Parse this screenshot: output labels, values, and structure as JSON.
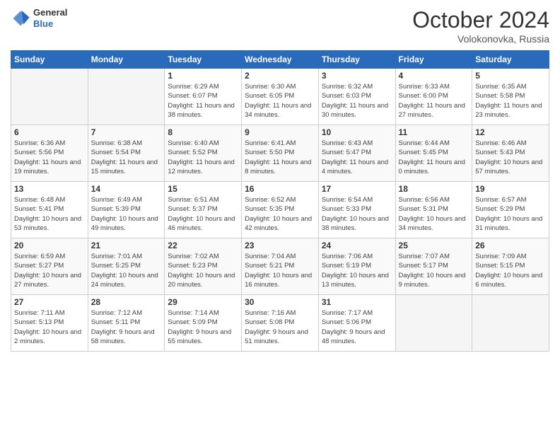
{
  "header": {
    "logo": {
      "general": "General",
      "blue": "Blue"
    },
    "title": "October 2024",
    "location": "Volokonovka, Russia"
  },
  "weekdays": [
    "Sunday",
    "Monday",
    "Tuesday",
    "Wednesday",
    "Thursday",
    "Friday",
    "Saturday"
  ],
  "weeks": [
    [
      {
        "day": "",
        "sunrise": "",
        "sunset": "",
        "daylight": "",
        "empty": true
      },
      {
        "day": "",
        "sunrise": "",
        "sunset": "",
        "daylight": "",
        "empty": true
      },
      {
        "day": "1",
        "sunrise": "Sunrise: 6:29 AM",
        "sunset": "Sunset: 6:07 PM",
        "daylight": "Daylight: 11 hours and 38 minutes."
      },
      {
        "day": "2",
        "sunrise": "Sunrise: 6:30 AM",
        "sunset": "Sunset: 6:05 PM",
        "daylight": "Daylight: 11 hours and 34 minutes."
      },
      {
        "day": "3",
        "sunrise": "Sunrise: 6:32 AM",
        "sunset": "Sunset: 6:03 PM",
        "daylight": "Daylight: 11 hours and 30 minutes."
      },
      {
        "day": "4",
        "sunrise": "Sunrise: 6:33 AM",
        "sunset": "Sunset: 6:00 PM",
        "daylight": "Daylight: 11 hours and 27 minutes."
      },
      {
        "day": "5",
        "sunrise": "Sunrise: 6:35 AM",
        "sunset": "Sunset: 5:58 PM",
        "daylight": "Daylight: 11 hours and 23 minutes."
      }
    ],
    [
      {
        "day": "6",
        "sunrise": "Sunrise: 6:36 AM",
        "sunset": "Sunset: 5:56 PM",
        "daylight": "Daylight: 11 hours and 19 minutes."
      },
      {
        "day": "7",
        "sunrise": "Sunrise: 6:38 AM",
        "sunset": "Sunset: 5:54 PM",
        "daylight": "Daylight: 11 hours and 15 minutes."
      },
      {
        "day": "8",
        "sunrise": "Sunrise: 6:40 AM",
        "sunset": "Sunset: 5:52 PM",
        "daylight": "Daylight: 11 hours and 12 minutes."
      },
      {
        "day": "9",
        "sunrise": "Sunrise: 6:41 AM",
        "sunset": "Sunset: 5:50 PM",
        "daylight": "Daylight: 11 hours and 8 minutes."
      },
      {
        "day": "10",
        "sunrise": "Sunrise: 6:43 AM",
        "sunset": "Sunset: 5:47 PM",
        "daylight": "Daylight: 11 hours and 4 minutes."
      },
      {
        "day": "11",
        "sunrise": "Sunrise: 6:44 AM",
        "sunset": "Sunset: 5:45 PM",
        "daylight": "Daylight: 11 hours and 0 minutes."
      },
      {
        "day": "12",
        "sunrise": "Sunrise: 6:46 AM",
        "sunset": "Sunset: 5:43 PM",
        "daylight": "Daylight: 10 hours and 57 minutes."
      }
    ],
    [
      {
        "day": "13",
        "sunrise": "Sunrise: 6:48 AM",
        "sunset": "Sunset: 5:41 PM",
        "daylight": "Daylight: 10 hours and 53 minutes."
      },
      {
        "day": "14",
        "sunrise": "Sunrise: 6:49 AM",
        "sunset": "Sunset: 5:39 PM",
        "daylight": "Daylight: 10 hours and 49 minutes."
      },
      {
        "day": "15",
        "sunrise": "Sunrise: 6:51 AM",
        "sunset": "Sunset: 5:37 PM",
        "daylight": "Daylight: 10 hours and 46 minutes."
      },
      {
        "day": "16",
        "sunrise": "Sunrise: 6:52 AM",
        "sunset": "Sunset: 5:35 PM",
        "daylight": "Daylight: 10 hours and 42 minutes."
      },
      {
        "day": "17",
        "sunrise": "Sunrise: 6:54 AM",
        "sunset": "Sunset: 5:33 PM",
        "daylight": "Daylight: 10 hours and 38 minutes."
      },
      {
        "day": "18",
        "sunrise": "Sunrise: 6:56 AM",
        "sunset": "Sunset: 5:31 PM",
        "daylight": "Daylight: 10 hours and 34 minutes."
      },
      {
        "day": "19",
        "sunrise": "Sunrise: 6:57 AM",
        "sunset": "Sunset: 5:29 PM",
        "daylight": "Daylight: 10 hours and 31 minutes."
      }
    ],
    [
      {
        "day": "20",
        "sunrise": "Sunrise: 6:59 AM",
        "sunset": "Sunset: 5:27 PM",
        "daylight": "Daylight: 10 hours and 27 minutes."
      },
      {
        "day": "21",
        "sunrise": "Sunrise: 7:01 AM",
        "sunset": "Sunset: 5:25 PM",
        "daylight": "Daylight: 10 hours and 24 minutes."
      },
      {
        "day": "22",
        "sunrise": "Sunrise: 7:02 AM",
        "sunset": "Sunset: 5:23 PM",
        "daylight": "Daylight: 10 hours and 20 minutes."
      },
      {
        "day": "23",
        "sunrise": "Sunrise: 7:04 AM",
        "sunset": "Sunset: 5:21 PM",
        "daylight": "Daylight: 10 hours and 16 minutes."
      },
      {
        "day": "24",
        "sunrise": "Sunrise: 7:06 AM",
        "sunset": "Sunset: 5:19 PM",
        "daylight": "Daylight: 10 hours and 13 minutes."
      },
      {
        "day": "25",
        "sunrise": "Sunrise: 7:07 AM",
        "sunset": "Sunset: 5:17 PM",
        "daylight": "Daylight: 10 hours and 9 minutes."
      },
      {
        "day": "26",
        "sunrise": "Sunrise: 7:09 AM",
        "sunset": "Sunset: 5:15 PM",
        "daylight": "Daylight: 10 hours and 6 minutes."
      }
    ],
    [
      {
        "day": "27",
        "sunrise": "Sunrise: 7:11 AM",
        "sunset": "Sunset: 5:13 PM",
        "daylight": "Daylight: 10 hours and 2 minutes."
      },
      {
        "day": "28",
        "sunrise": "Sunrise: 7:12 AM",
        "sunset": "Sunset: 5:11 PM",
        "daylight": "Daylight: 9 hours and 58 minutes."
      },
      {
        "day": "29",
        "sunrise": "Sunrise: 7:14 AM",
        "sunset": "Sunset: 5:09 PM",
        "daylight": "Daylight: 9 hours and 55 minutes."
      },
      {
        "day": "30",
        "sunrise": "Sunrise: 7:16 AM",
        "sunset": "Sunset: 5:08 PM",
        "daylight": "Daylight: 9 hours and 51 minutes."
      },
      {
        "day": "31",
        "sunrise": "Sunrise: 7:17 AM",
        "sunset": "Sunset: 5:06 PM",
        "daylight": "Daylight: 9 hours and 48 minutes."
      },
      {
        "day": "",
        "sunrise": "",
        "sunset": "",
        "daylight": "",
        "empty": true
      },
      {
        "day": "",
        "sunrise": "",
        "sunset": "",
        "daylight": "",
        "empty": true
      }
    ]
  ]
}
